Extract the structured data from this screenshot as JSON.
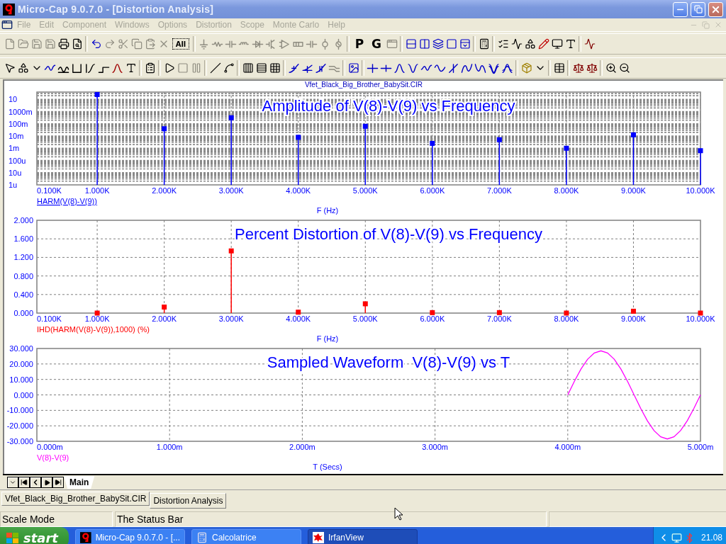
{
  "window": {
    "title": "Micro-Cap 9.0.7.0 - [Distortion Analysis]"
  },
  "menu": [
    {
      "label": "File",
      "disabled": true
    },
    {
      "label": "Edit",
      "disabled": true
    },
    {
      "label": "Component",
      "disabled": true
    },
    {
      "label": "Windows",
      "disabled": true
    },
    {
      "label": "Options",
      "disabled": true
    },
    {
      "label": "Distortion",
      "disabled": true
    },
    {
      "label": "Scope",
      "disabled": true
    },
    {
      "label": "Monte Carlo",
      "disabled": true
    },
    {
      "label": "Help",
      "disabled": true
    }
  ],
  "toolbar_text_buttons": [
    "All",
    "P",
    "G"
  ],
  "document": {
    "file_name": "Vfet_Black_Big_Brother_BabySit.CIR"
  },
  "plots": [
    {
      "kind": "picture",
      "title": "Amplitude of V(8)-V(9) vs Frequency",
      "xlabel": "F (Hz)",
      "series_name": "HARM(V(8)-V(9))",
      "y_axis_labels": [
        "10",
        "1000m",
        "100m",
        "10m",
        "1m",
        "100u",
        "10u",
        "1u"
      ],
      "x_axis_labels": [
        "0.100K",
        "1.000K",
        "2.000K",
        "3.000K",
        "4.000K",
        "5.000K",
        "6.000K",
        "7.000K",
        "8.000K",
        "9.000K",
        "10.000K"
      ]
    },
    {
      "chart_data": {
        "type": "scatter",
        "title": "Percent Distortion of V(8)-V(9) vs Frequency",
        "xlabel": "F (Hz)",
        "grid": true,
        "x": [
          1000,
          2000,
          3000,
          4000,
          5000,
          6000,
          7000,
          8000,
          9000,
          10000
        ],
        "series": [
          {
            "name": "IHD(HARM(V(8)-V(9)),1000) (%)",
            "color": "#ff0000",
            "values": [
              0,
              0.13,
              1.34,
              0.02,
              0.2,
              0.01,
              0.01,
              0,
              0.04,
              0
            ]
          }
        ],
        "xlim": [
          100,
          10000
        ],
        "ylim": [
          0,
          2
        ],
        "xticks": [
          {
            "value": 100,
            "label": "0.100K"
          },
          {
            "value": 1000,
            "label": "1.000K"
          },
          {
            "value": 2000,
            "label": "2.000K"
          },
          {
            "value": 3000,
            "label": "3.000K"
          },
          {
            "value": 4000,
            "label": "4.000K"
          },
          {
            "value": 5000,
            "label": "5.000K"
          },
          {
            "value": 6000,
            "label": "6.000K"
          },
          {
            "value": 7000,
            "label": "7.000K"
          },
          {
            "value": 8000,
            "label": "8.000K"
          },
          {
            "value": 9000,
            "label": "9.000K"
          },
          {
            "value": 10000,
            "label": "10.000K"
          }
        ],
        "yticks": [
          {
            "value": 2,
            "label": "2.000"
          },
          {
            "value": 1.6,
            "label": "1.600"
          },
          {
            "value": 1.2,
            "label": "1.200"
          },
          {
            "value": 0.8,
            "label": "0.800"
          },
          {
            "value": 0.4,
            "label": "0.400"
          },
          {
            "value": 0,
            "label": "0.000"
          }
        ]
      }
    },
    {
      "chart_data": {
        "type": "line",
        "title": "Sampled Waveform  V(8)-V(9) vs T",
        "xlabel": "T (Secs)",
        "grid": true,
        "x": [
          4,
          4.05,
          4.1,
          4.15,
          4.2,
          4.25,
          4.3,
          4.35,
          4.4,
          4.45,
          4.5,
          4.55,
          4.6,
          4.65,
          4.7,
          4.75,
          4.8,
          4.85,
          4.9,
          4.95,
          5
        ],
        "series": [
          {
            "name": "V(8)-V(9)",
            "color": "#ff00ff",
            "values": [
              0,
              8.8,
              16.8,
              23.1,
              27.1,
              28.5,
              27.1,
              23.1,
              16.8,
              8.8,
              0,
              -8.8,
              -16.8,
              -23.1,
              -27.1,
              -28.5,
              -27.1,
              -23.1,
              -16.8,
              -8.8,
              0
            ]
          }
        ],
        "xlim": [
          0,
          5
        ],
        "ylim": [
          -30,
          30
        ],
        "xticks": [
          {
            "value": 0,
            "label": "0.000m"
          },
          {
            "value": 1,
            "label": "1.000m"
          },
          {
            "value": 2,
            "label": "2.000m"
          },
          {
            "value": 3,
            "label": "3.000m"
          },
          {
            "value": 4,
            "label": "4.000m"
          },
          {
            "value": 5,
            "label": "5.000m"
          }
        ],
        "yticks": [
          {
            "value": 30,
            "label": "30.000"
          },
          {
            "value": 20,
            "label": "20.000"
          },
          {
            "value": 10,
            "label": "10.000"
          },
          {
            "value": 0,
            "label": "0.000"
          },
          {
            "value": -10,
            "label": "-10.000"
          },
          {
            "value": -20,
            "label": "-20.000"
          },
          {
            "value": -30,
            "label": "-30.000"
          }
        ]
      }
    }
  ],
  "sheet_tabs": [
    {
      "label": "Main",
      "selected": true
    }
  ],
  "document_tabs": [
    {
      "label": "Vfet_Black_Big_Brother_BabySit.CIR",
      "selected": false
    },
    {
      "label": "Distortion Analysis",
      "selected": true
    }
  ],
  "status_bar": {
    "panels": [
      "Scale Mode",
      "The Status Bar"
    ]
  },
  "taskbar": {
    "start": "start",
    "tasks": [
      {
        "label": "Micro-Cap 9.0.7.0 - [...",
        "kind": "microcap",
        "selected": false
      },
      {
        "label": "Calcolatrice",
        "kind": "calculator",
        "selected": false
      },
      {
        "label": "IrfanView",
        "kind": "irfanview",
        "selected": true
      }
    ],
    "clock": "21.08"
  }
}
